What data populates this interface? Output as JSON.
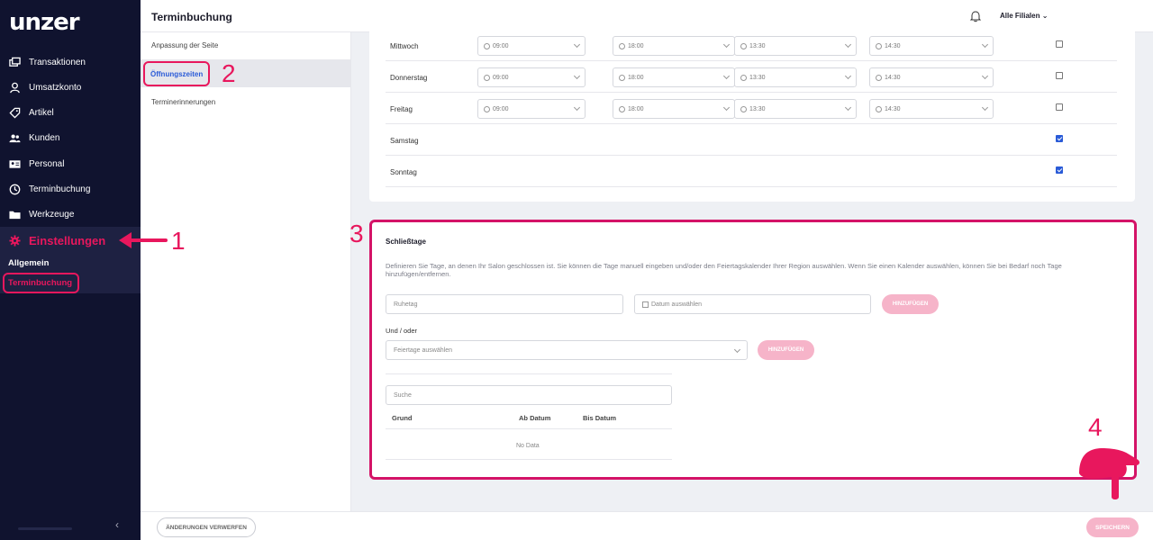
{
  "sidebar": {
    "logo": "unzer",
    "items": [
      {
        "label": "Transaktionen",
        "icon": "transactions-icon"
      },
      {
        "label": "Umsatzkonto",
        "icon": "user-icon"
      },
      {
        "label": "Artikel",
        "icon": "tag-icon"
      },
      {
        "label": "Kunden",
        "icon": "customers-icon"
      },
      {
        "label": "Personal",
        "icon": "id-card-icon"
      },
      {
        "label": "Terminbuchung",
        "icon": "clock-icon"
      },
      {
        "label": "Werkzeuge",
        "icon": "folder-icon"
      },
      {
        "label": "Einstellungen",
        "icon": "gear-icon"
      }
    ],
    "sub_items": [
      "Allgemein",
      "Terminbuchung"
    ],
    "collapse": "‹"
  },
  "header": {
    "title": "Terminbuchung",
    "branch": "Alle Filialen",
    "branch_chevron": "⌄"
  },
  "subnav": {
    "items": [
      "Anpassung der Seite",
      "Öffnungszeiten",
      "Terminerinnerungen"
    ]
  },
  "opening_hours": {
    "days": [
      {
        "name": "Mittwoch",
        "times": [
          "09:00",
          "18:00",
          "13:30",
          "14:30"
        ],
        "closed": false
      },
      {
        "name": "Donnerstag",
        "times": [
          "09:00",
          "18:00",
          "13:30",
          "14:30"
        ],
        "closed": false
      },
      {
        "name": "Freitag",
        "times": [
          "09:00",
          "18:00",
          "13:30",
          "14:30"
        ],
        "closed": false
      },
      {
        "name": "Samstag",
        "times": [],
        "closed": true
      },
      {
        "name": "Sonntag",
        "times": [],
        "closed": true
      }
    ]
  },
  "closing_days": {
    "title": "Schließtage",
    "description": "Definieren Sie Tage, an denen Ihr Salon geschlossen ist. Sie können die Tage manuell eingeben und/oder den Feiertagskalender Ihrer Region auswählen. Wenn Sie einen Kalender auswählen, können Sie bei Bedarf noch Tage hinzufügen/entfernen.",
    "rest_day_placeholder": "Ruhetag",
    "date_placeholder": "Datum auswählen",
    "add_label": "HINZUFÜGEN",
    "and_or": "Und / oder",
    "holiday_placeholder": "Feiertage auswählen",
    "search_placeholder": "Suche",
    "columns": [
      "Grund",
      "Ab Datum",
      "Bis Datum"
    ],
    "empty": "No Data"
  },
  "footer": {
    "discard": "ÄNDERUNGEN VERWERFEN",
    "save": "SPEICHERN"
  },
  "annotations": [
    "1",
    "2",
    "3",
    "4"
  ],
  "colors": {
    "accent": "#e8175d",
    "sidebar": "#10132f",
    "link": "#2a5bd7",
    "button_disabled": "#f6b4c9"
  }
}
